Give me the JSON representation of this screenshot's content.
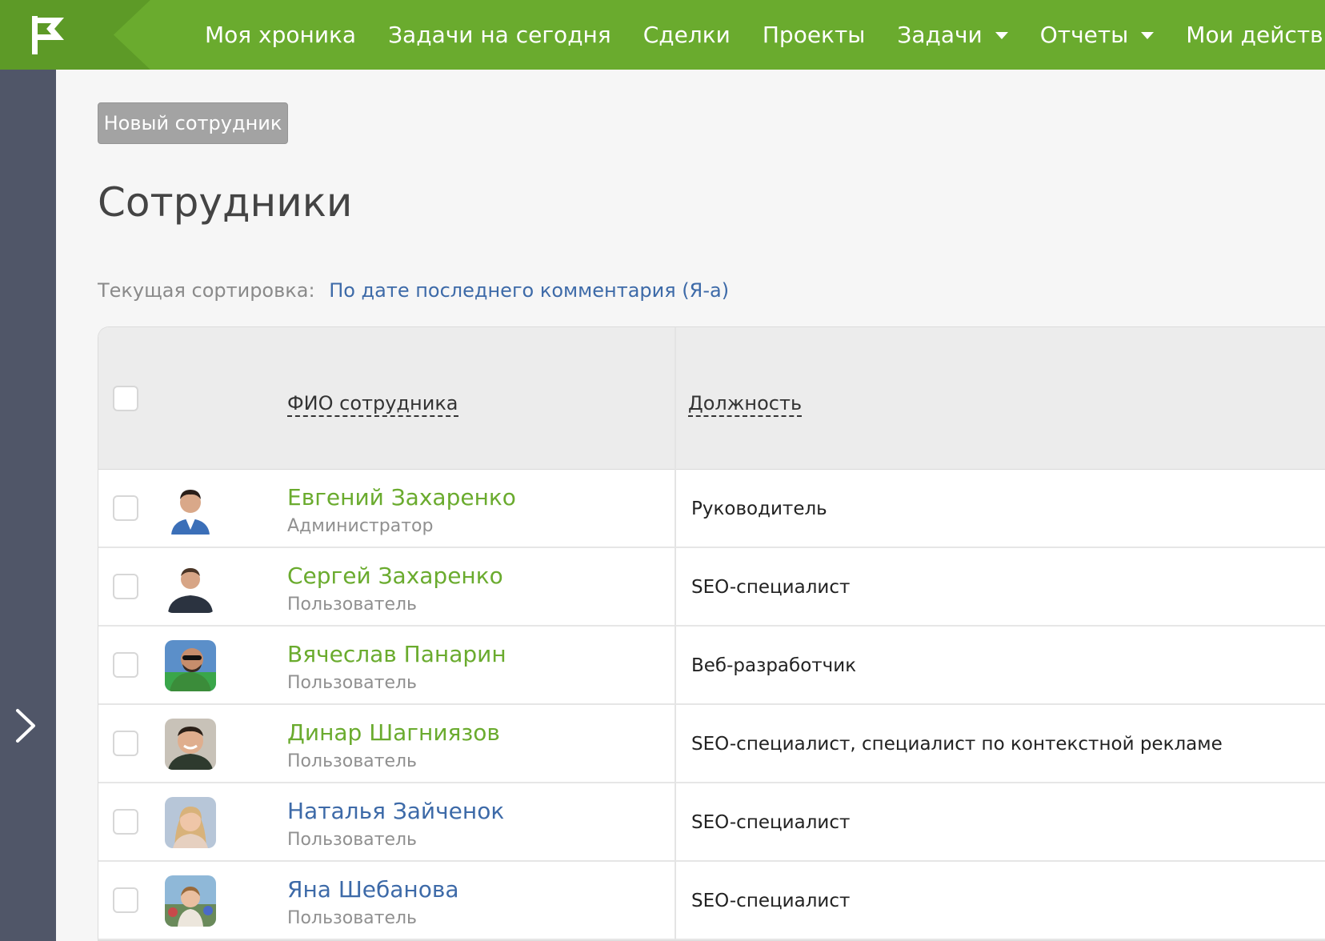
{
  "nav": {
    "items": [
      {
        "label": "Моя хроника",
        "dropdown": false
      },
      {
        "label": "Задачи на сегодня",
        "dropdown": false
      },
      {
        "label": "Сделки",
        "dropdown": false
      },
      {
        "label": "Проекты",
        "dropdown": false
      },
      {
        "label": "Задачи",
        "dropdown": true
      },
      {
        "label": "Отчеты",
        "dropdown": true
      },
      {
        "label": "Мои действия",
        "dropdown": false
      }
    ]
  },
  "colors": {
    "brand": "#6aab2e",
    "brand_dark": "#5d9a27",
    "sidebar": "#505668",
    "link_green": "#6aab2e",
    "link_blue": "#3d6aa8"
  },
  "toolbar": {
    "new_employee_label": "Новый сотрудник"
  },
  "page": {
    "title": "Сотрудники"
  },
  "sort": {
    "label": "Текущая сортировка:",
    "value": "По дате последнего комментария (Я-а)"
  },
  "table": {
    "headers": {
      "name": "ФИО сотрудника",
      "position": "Должность"
    },
    "rows": [
      {
        "name": "Евгений Захаренко",
        "role": "Администратор",
        "position": "Руководитель",
        "name_color": "green",
        "avatar": "man-suit-avatar"
      },
      {
        "name": "Сергей Захаренко",
        "role": "Пользователь",
        "position": "SEO-специалист",
        "name_color": "green",
        "avatar": "man-tshirt-avatar"
      },
      {
        "name": "Вячеслав Панарин",
        "role": "Пользователь",
        "position": "Веб-разработчик",
        "name_color": "green",
        "avatar": "man-sunglasses-avatar"
      },
      {
        "name": "Динар Шагниязов",
        "role": "Пользователь",
        "position": "SEO-специалист, специалист по контекстной рекламе",
        "name_color": "green",
        "avatar": "man-smiling-avatar"
      },
      {
        "name": "Наталья Зайченок",
        "role": "Пользователь",
        "position": "SEO-специалист",
        "name_color": "blue",
        "avatar": "woman-blonde-avatar"
      },
      {
        "name": "Яна Шебанова",
        "role": "Пользователь",
        "position": "SEO-специалист",
        "name_color": "blue",
        "avatar": "woman-outdoor-avatar"
      }
    ]
  }
}
